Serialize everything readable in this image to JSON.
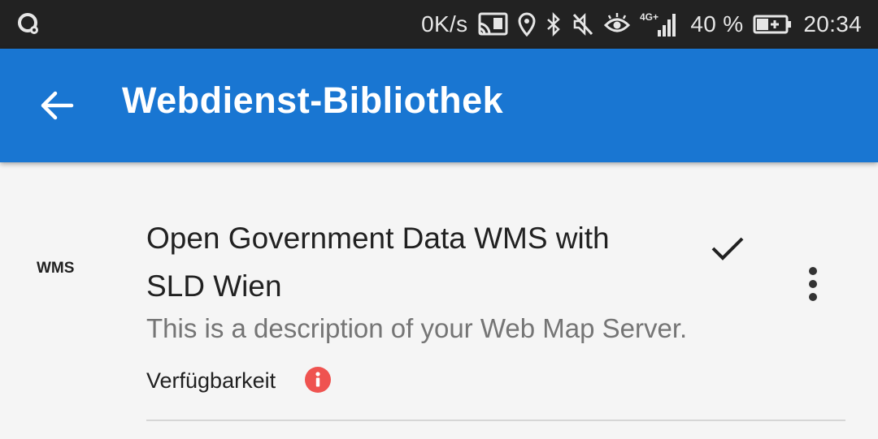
{
  "status_bar": {
    "network_speed": "0K/s",
    "network_type": "4G+",
    "battery_percent": "40 %",
    "time": "20:34",
    "icons": [
      "app-notification-icon",
      "cast-icon",
      "location-icon",
      "bluetooth-icon",
      "mute-icon",
      "eye-comfort-icon",
      "signal-icon",
      "battery-charging-icon"
    ]
  },
  "app_bar": {
    "title": "Webdienst-Bibliothek",
    "background_color": "#1976d2",
    "back_icon": "arrow-back-icon"
  },
  "services": [
    {
      "type": "WMS",
      "title": "Open Government Data WMS with SLD Wien",
      "description": "This is a description of your Web Map Server.",
      "selected": true,
      "availability_label": "Verfügbarkeit",
      "availability_status_color": "#ef5350",
      "availability_icon": "info-icon",
      "menu_icon": "more-vert-icon"
    }
  ]
}
